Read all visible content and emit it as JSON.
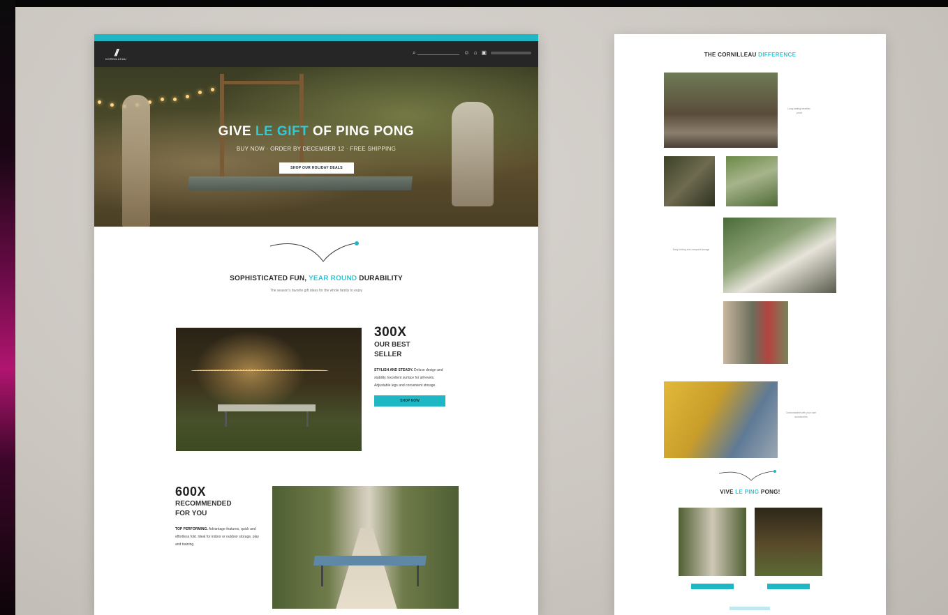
{
  "left_page": {
    "hero": {
      "title_pre": "GIVE ",
      "title_accent": "LE GIFT",
      "title_post": " OF PING PONG",
      "subtitle": "BUY NOW · ORDER BY DECEMBER 12 · FREE SHIPPING",
      "button": "SHOP OUR HOLIDAY DEALS"
    },
    "section": {
      "title_pre": "SOPHISTICATED FUN, ",
      "title_accent": "YEAR ROUND",
      "title_post": " DURABILITY",
      "subtitle": "The season's favorite gift ideas for the whole family to enjoy"
    },
    "product1": {
      "stat": "300X",
      "label_line1": "OUR BEST",
      "label_line2": "SELLER",
      "desc_bold": "STYLISH AND STEADY.",
      "desc": "Deluxe design and stability. Excellent surface for all levels. Adjustable legs and convenient storage.",
      "cta": "SHOP NOW"
    },
    "product2": {
      "stat": "600X",
      "label_line1": "RECOMMENDED",
      "label_line2": "FOR YOU",
      "desc_bold": "TOP PERFORMING.",
      "desc": "Advantage features, quick and effortless fold. Ideal for indoor or outdoor storage, play and training."
    }
  },
  "right_page": {
    "title_pre": "THE CORNILLEAU ",
    "title_accent": "DIFFERENCE",
    "caption_1": "Long-lasting weather-proof",
    "caption_2": "Easy folding and compact storage",
    "caption_3": "Customizable with your own accessories",
    "footer_title_pre": "VIVE ",
    "footer_title_accent": "LE PING",
    "footer_title_post": " PONG!"
  },
  "colors": {
    "accent": "#1fb7c4",
    "teal_text": "#2ec9d6",
    "nav": "#262626"
  }
}
